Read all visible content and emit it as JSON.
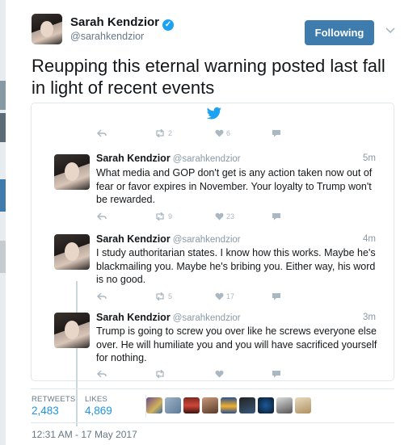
{
  "author": {
    "name": "Sarah Kendzior",
    "handle": "@sarahkendzior",
    "verified": true
  },
  "follow_button_label": "Following",
  "tweet_text": "Reupping this eternal warning posted last fall in light of recent events",
  "embedded_thread": {
    "top_actions": {
      "retweets": "2",
      "likes": "6"
    },
    "tweets": [
      {
        "name": "Sarah Kendzior",
        "handle": "@sarahkendzior",
        "time": "5m",
        "text": "What media and GOP don't get is any action taken now out of fear or favor expires in November. Your loyalty to Trump won't be rewarded.",
        "retweets": "9",
        "likes": "23"
      },
      {
        "name": "Sarah Kendzior",
        "handle": "@sarahkendzior",
        "time": "4m",
        "text": "I study authoritarian states. I know how this works. Maybe he's blackmailing you. Maybe he's bribing you. Either way, his word is no good.",
        "retweets": "5",
        "likes": "17"
      },
      {
        "name": "Sarah Kendzior",
        "handle": "@sarahkendzior",
        "time": "3m",
        "text": "Trump is going to screw you over like he screws everyone else over. He will humiliate you and you will have sacrificed yourself for nothing.",
        "retweets": "",
        "likes": ""
      }
    ]
  },
  "stats": {
    "retweets_label": "RETWEETS",
    "retweets_value": "2,483",
    "likes_label": "LIKES",
    "likes_value": "4,869"
  },
  "timestamp": "12:31 AM - 17 May 2017",
  "colors": {
    "brand_blue": "#1da1f2",
    "follow_button": "#3e7cae",
    "link_blue": "#1b95e0"
  }
}
